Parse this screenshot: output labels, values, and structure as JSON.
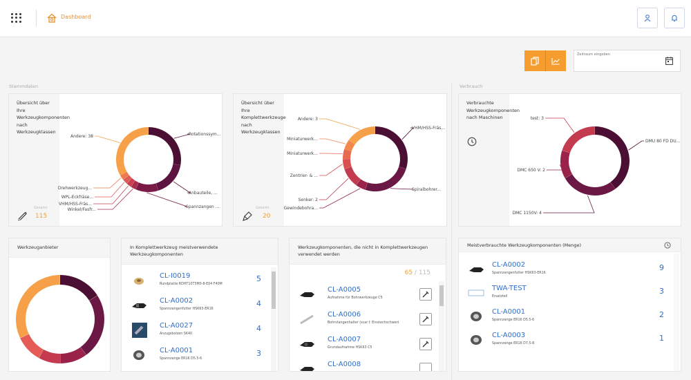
{
  "header": {
    "breadcrumb": "Dashboard"
  },
  "toolbar": {
    "date_placeholder": "Zeitraum eingeben"
  },
  "sections": {
    "stammdaten": "Stammdaten",
    "verbrauch": "Verbrauch"
  },
  "colors": {
    "accent": "#f59e2f",
    "link": "#2f6ec9"
  },
  "cards": [
    {
      "title": "Übersicht über Ihre Werkzeugkomponenten nach Werkzeugklassen",
      "total_label": "Gesamt",
      "total": "115",
      "icon": "tool-icon",
      "chart_data": {
        "type": "pie",
        "slices": [
          {
            "label": "Rotationssym...",
            "value": 32,
            "color": "#4a0f32"
          },
          {
            "label": "Anbauteile, ...",
            "value": 20,
            "color": "#5e1440"
          },
          {
            "label": "Spannzangen ...",
            "value": 13,
            "color": "#7a1a47"
          },
          {
            "label": "Winkel/Fasfr...",
            "value": 3,
            "color": "#a92c4c"
          },
          {
            "label": "VHM/HSS-Fräs...",
            "value": 3,
            "color": "#c84052"
          },
          {
            "label": "WPL-Eckfräse...",
            "value": 3,
            "color": "#de5c55"
          },
          {
            "label": "Drehwerkzeug...",
            "value": 3,
            "color": "#ee7a4e"
          },
          {
            "label": "Andere: 38",
            "value": 38,
            "color": "#f6a04a"
          }
        ]
      }
    },
    {
      "title": "Übersicht über Ihre Komplettwerkzeuge nach Werkzeugklassen",
      "total_label": "Gesamt",
      "total": "20",
      "icon": "drill-icon",
      "chart_data": {
        "type": "pie",
        "slices": [
          {
            "label": "VHM/HSS-Fräs...",
            "value": 6,
            "color": "#4a0f32"
          },
          {
            "label": "Spiralbohrer...",
            "value": 5,
            "color": "#6b1845"
          },
          {
            "label": "Gewindebohra...",
            "value": 1,
            "color": "#9a2449"
          },
          {
            "label": "Senker: 2",
            "value": 2,
            "color": "#c43a4f"
          },
          {
            "label": "Zentrier- & ...",
            "value": 1,
            "color": "#d9504f"
          },
          {
            "label": "Miniaturwerk...",
            "value": 1,
            "color": "#e86a50"
          },
          {
            "label": "Miniaturwerk...",
            "value": 1,
            "color": "#f2884c"
          },
          {
            "label": "Andere: 3",
            "value": 3,
            "color": "#f6a04a"
          }
        ]
      }
    },
    {
      "title": "Verbrauchte Werkzeugkomponenten nach Maschinen",
      "icon": "clock-icon",
      "chart_data": {
        "type": "pie",
        "slices": [
          {
            "label": "DMU 80 FD DU...",
            "value": 6,
            "color": "#4a0f32"
          },
          {
            "label": "DMC 1150V: 4",
            "value": 4,
            "color": "#6b1845"
          },
          {
            "label": "DMC 650 V: 2",
            "value": 2,
            "color": "#9a2449"
          },
          {
            "label": "test: 3",
            "value": 3,
            "color": "#c43a4f"
          }
        ]
      }
    }
  ],
  "anbieter": {
    "title": "Werkzeuganbieter",
    "chart_data": {
      "type": "pie",
      "slices": [
        {
          "value": 16,
          "color": "#4a0f32"
        },
        {
          "value": 24,
          "color": "#6b1845"
        },
        {
          "value": 10,
          "color": "#9a2449"
        },
        {
          "value": 8,
          "color": "#c43a4f"
        },
        {
          "value": 10,
          "color": "#e45c55"
        },
        {
          "value": 32,
          "color": "#f6a04a"
        }
      ]
    }
  },
  "panel_most_used": {
    "title": "In Komplettwerkzeug meistverwendete Werkzeugkomponenten",
    "items": [
      {
        "code": "CL-I0019",
        "desc": "Rundplatte RDHT10T3M0-8-E04 F40M",
        "count": "5",
        "thumb": "insert-icon"
      },
      {
        "code": "CL-A0002",
        "desc": "Spannzangenfutter HSK63-ER16",
        "count": "4",
        "thumb": "holder-icon"
      },
      {
        "code": "CL-A0027",
        "desc": "Anzugsbolzen SK40",
        "count": "4",
        "thumb": "bolt-icon"
      },
      {
        "code": "CL-A0001",
        "desc": "Spannzange ER16 D5.5-6",
        "count": "3",
        "thumb": "collet-icon"
      }
    ]
  },
  "panel_unused": {
    "title": "Werkzeugkomponenten, die nicht in Komplettwerkzeugen verwendet werden",
    "ratio_used": "65",
    "ratio_sep": " / ",
    "ratio_total": "115",
    "items": [
      {
        "code": "CL-A0005",
        "desc": "Aufnahme für Bohrwerkzeuge C5",
        "thumb": "holder-icon"
      },
      {
        "code": "CL-A0006",
        "desc": "Bohrstangenhalter (scar f. Einstechschwert",
        "thumb": "bar-icon"
      },
      {
        "code": "CL-A0007",
        "desc": "Grundaufnahme HSK63 C5",
        "thumb": "holder-icon"
      },
      {
        "code": "CL-A0008",
        "desc": "",
        "thumb": "holder-icon"
      }
    ]
  },
  "panel_consumed": {
    "title": "Meistverbrauchte Werkzeugkomponenten (Menge)",
    "items": [
      {
        "code": "CL-A0002",
        "desc": "Spannzangenfutter HSK63-ER16",
        "count": "9",
        "thumb": "holder-icon"
      },
      {
        "code": "TWA-TEST",
        "desc": "Ersatzteil",
        "count": "3",
        "thumb": "placeholder-icon"
      },
      {
        "code": "CL-A0001",
        "desc": "Spannzange ER16 D5.5-6",
        "count": "2",
        "thumb": "collet-icon"
      },
      {
        "code": "CL-A0003",
        "desc": "Spannzange ER16 D7.5-8",
        "count": "1",
        "thumb": "collet-icon"
      }
    ]
  }
}
